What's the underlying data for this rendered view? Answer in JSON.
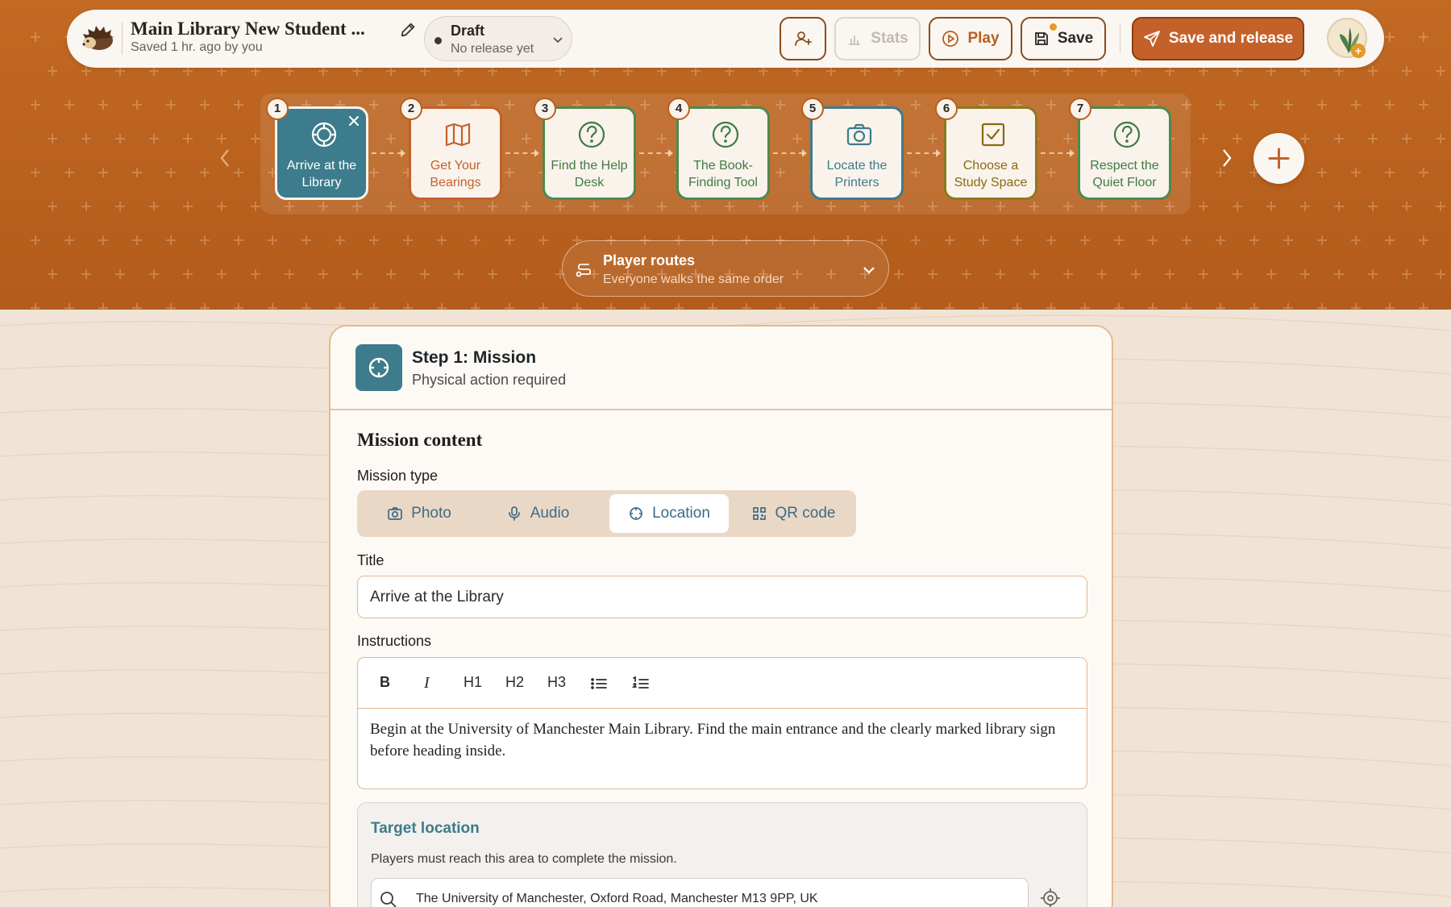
{
  "project": {
    "title": "Main Library New Student ...",
    "saved": "Saved 1 hr. ago by you"
  },
  "release": {
    "status": "Draft",
    "sub": "No release yet"
  },
  "toolbar": {
    "stats": "Stats",
    "play": "Play",
    "save": "Save",
    "save_release": "Save and release"
  },
  "steps": [
    {
      "num": "1",
      "label": "Arrive at the Library",
      "icon": "crosshair-icon"
    },
    {
      "num": "2",
      "label": "Get Your Bearings",
      "icon": "map-icon"
    },
    {
      "num": "3",
      "label": "Find the Help Desk",
      "icon": "question-icon"
    },
    {
      "num": "4",
      "label": "The Book-Finding Tool",
      "icon": "question-icon"
    },
    {
      "num": "5",
      "label": "Locate the Printers",
      "icon": "camera-icon"
    },
    {
      "num": "6",
      "label": "Choose a Study Space",
      "icon": "checkbox-icon"
    },
    {
      "num": "7",
      "label": "Respect the Quiet Floor",
      "icon": "question-icon"
    }
  ],
  "routes": {
    "title": "Player routes",
    "sub": "Everyone walks the same order"
  },
  "card": {
    "title": "Step 1: Mission",
    "sub": "Physical action required",
    "section": "Mission content",
    "mission_type_label": "Mission type",
    "types": [
      "Photo",
      "Audio",
      "Location",
      "QR code"
    ],
    "selected_type": "Location",
    "title_label": "Title",
    "title_value": "Arrive at the Library",
    "instructions_label": "Instructions",
    "toolbar": [
      "B",
      "I",
      "H1",
      "H2",
      "H3"
    ],
    "instructions_text": "Begin at the University of Manchester Main Library. Find the main entrance and the clearly marked library sign before heading inside.",
    "target_title": "Target location",
    "target_sub": "Players must reach this area to complete the mission.",
    "location_value": "The University of Manchester, Oxford Road, Manchester M13 9PP, UK"
  },
  "colors": {
    "band": "#b8601d",
    "teal": "#3c7c8c",
    "primary": "#c4612a"
  }
}
